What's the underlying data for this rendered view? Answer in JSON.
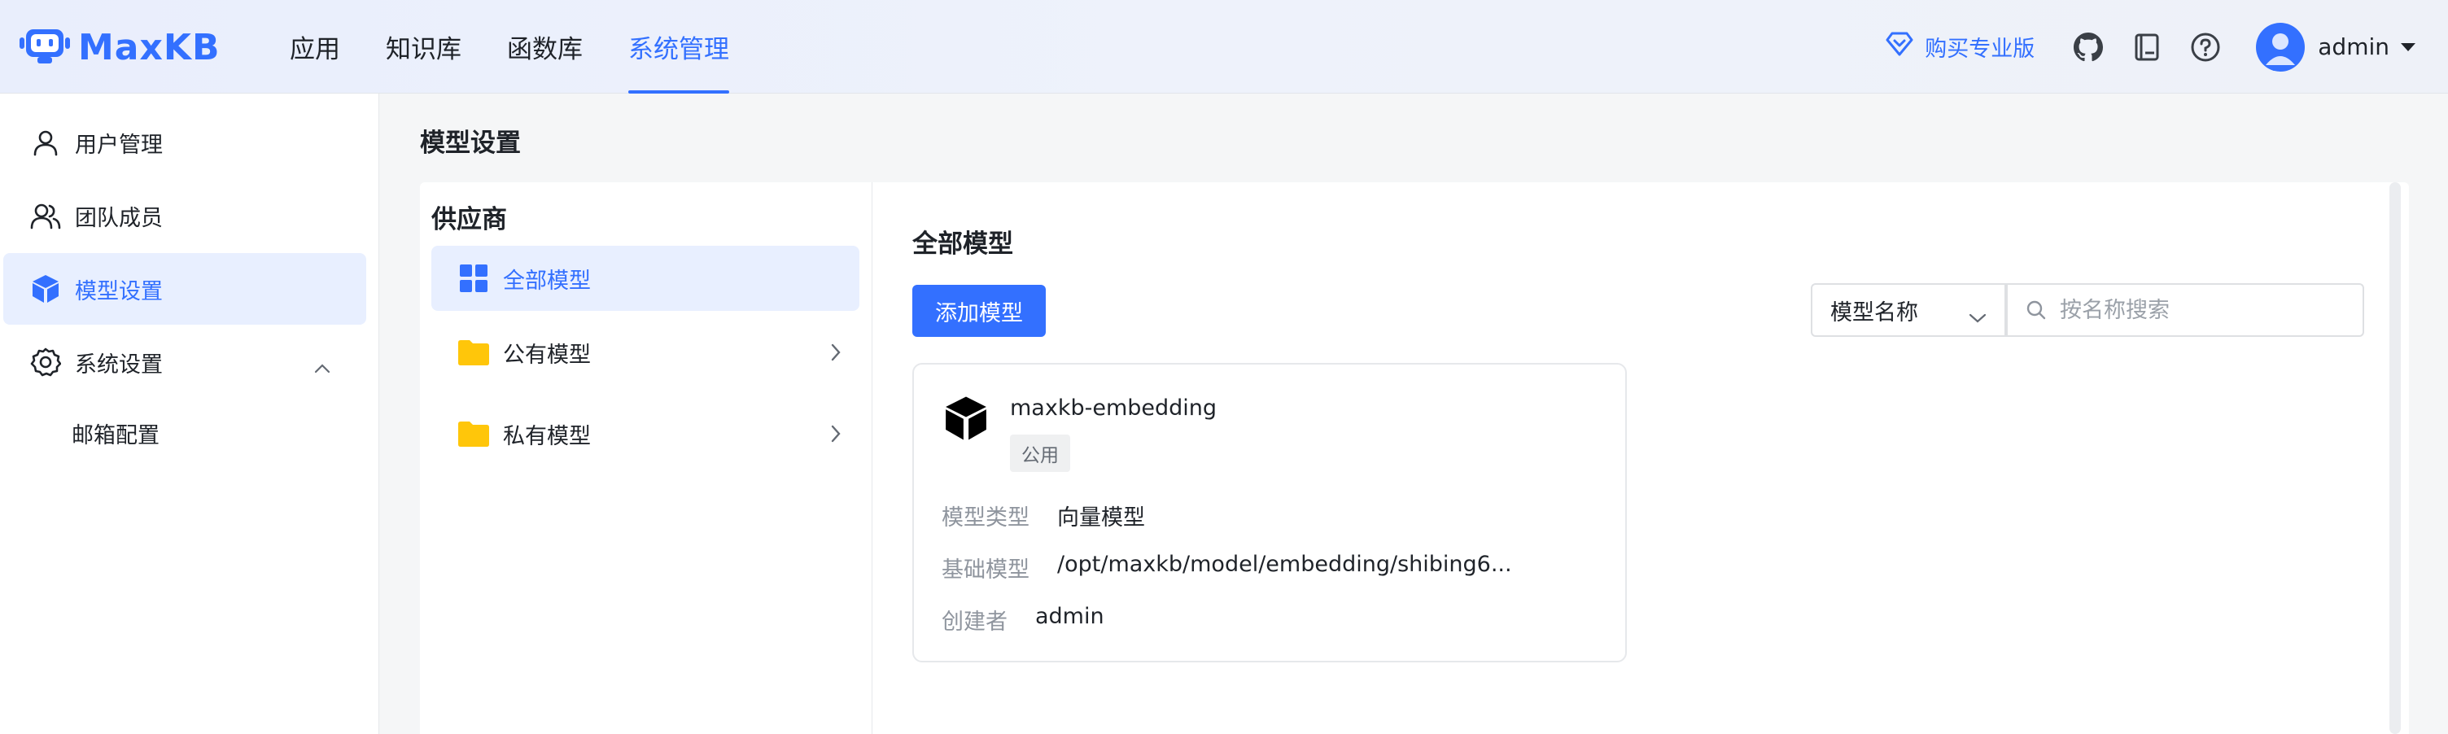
{
  "header": {
    "logo_text": "MaxKB",
    "nav": [
      {
        "label": "应用"
      },
      {
        "label": "知识库"
      },
      {
        "label": "函数库"
      },
      {
        "label": "系统管理"
      }
    ],
    "active_nav": "系统管理",
    "upgrade_label": "购买专业版",
    "username": "admin",
    "icons": [
      "github-icon",
      "book-icon",
      "help-icon"
    ]
  },
  "sidebar": {
    "items": [
      {
        "label": "用户管理",
        "icon": "user-icon"
      },
      {
        "label": "团队成员",
        "icon": "team-icon"
      },
      {
        "label": "模型设置",
        "icon": "cube-icon"
      },
      {
        "label": "系统设置",
        "icon": "gear-icon"
      }
    ],
    "active": "模型设置",
    "sub_items": [
      {
        "label": "邮箱配置"
      }
    ]
  },
  "main": {
    "page_title": "模型设置",
    "provider": {
      "title": "供应商",
      "items": [
        {
          "label": "全部模型",
          "icon": "grid-icon"
        },
        {
          "label": "公有模型",
          "icon": "folder-icon"
        },
        {
          "label": "私有模型",
          "icon": "folder-icon"
        }
      ],
      "active": "全部模型"
    },
    "content": {
      "title": "全部模型",
      "add_button": "添加模型",
      "filter_select": "模型名称",
      "search_placeholder": "按名称搜索"
    },
    "cards": [
      {
        "name": "maxkb-embedding",
        "badge": "公用",
        "fields": [
          {
            "key": "模型类型",
            "value": "向量模型"
          },
          {
            "key": "基础模型",
            "value": "/opt/maxkb/model/embedding/shibing6..."
          },
          {
            "key": "创建者",
            "value": "admin"
          }
        ]
      }
    ]
  },
  "colors": {
    "accent": "#3370ff",
    "folder": "#ffc60a",
    "text": "#1f2329",
    "muted": "#8f959e"
  }
}
